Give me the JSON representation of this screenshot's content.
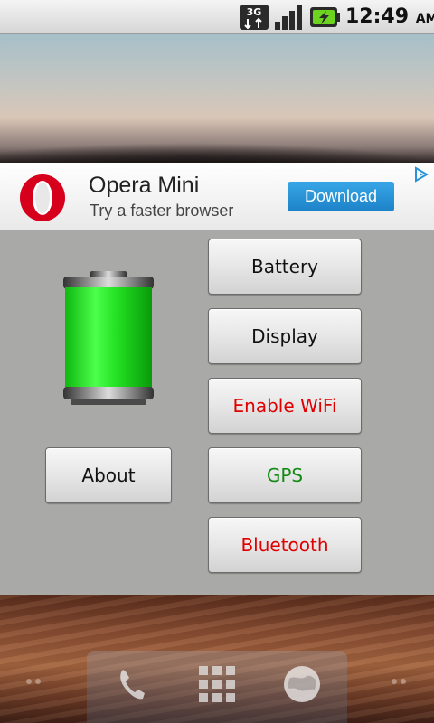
{
  "status_bar": {
    "network_type": "3G",
    "time": "12:49",
    "ampm": "AM",
    "icons": [
      "3g-data-icon",
      "signal-strength-icon",
      "battery-charging-icon"
    ]
  },
  "ad": {
    "title": "Opera Mini",
    "subtitle": "Try a faster browser",
    "button_label": "Download",
    "logo": "opera-logo",
    "badge_icon": "adchoices-icon",
    "colors": {
      "brand": "#d6001c",
      "button": "#2a93d8"
    }
  },
  "panel": {
    "battery_graphic": "battery-full-icon",
    "buttons": {
      "about": "About",
      "battery": "Battery",
      "display": "Display",
      "wifi": "Enable WiFi",
      "gps": "GPS",
      "bluetooth": "Bluetooth"
    },
    "colors": {
      "wifi": "#e00000",
      "gps": "#138a13",
      "bluetooth": "#e00000",
      "battery_fill": "#22e022"
    }
  },
  "dock": {
    "icons": [
      "phone-icon",
      "app-drawer-icon",
      "browser-icon"
    ]
  }
}
